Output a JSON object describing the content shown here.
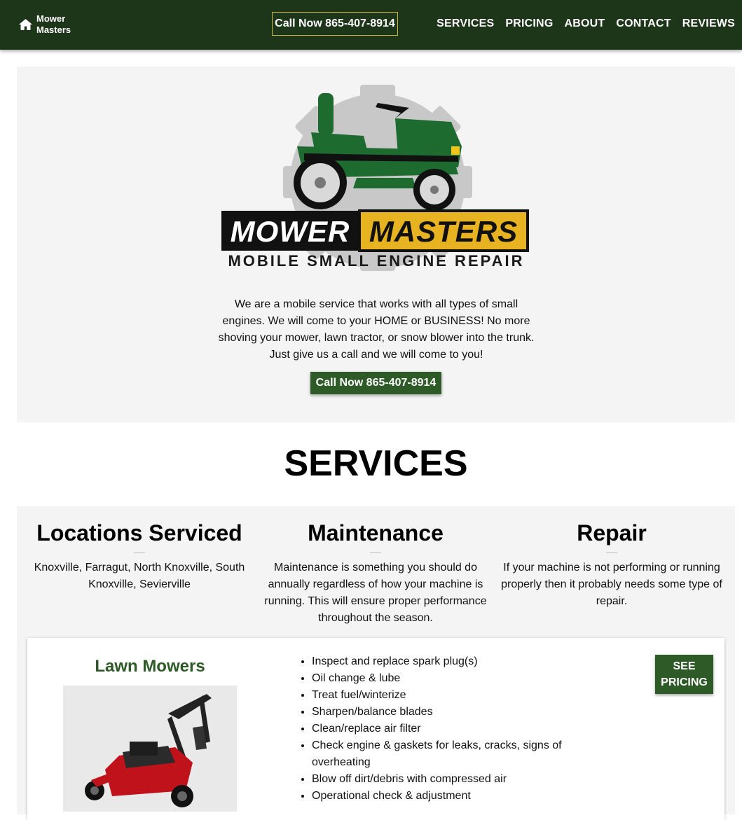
{
  "nav": {
    "brand_line1": "Mower",
    "brand_line2": "Masters",
    "call_label": "Call Now 865-407-8914",
    "links": [
      "SERVICES",
      "PRICING",
      "ABOUT",
      "CONTACT",
      "REVIEWS"
    ]
  },
  "hero": {
    "logo_word1": "MOWER",
    "logo_word2": "MASTERS",
    "tagline": "MOBILE SMALL ENGINE REPAIR",
    "description": "We are a mobile service that works with all types of small engines. We will come to your HOME or BUSINESS! No more shoving your mower, lawn tractor, or snow blower into the trunk. Just give us a call and we will come to you!",
    "call_label": "Call Now 865-407-8914"
  },
  "services": {
    "title": "SERVICES",
    "columns": [
      {
        "title": "Locations Serviced",
        "text": "Knoxville, Farragut, North Knoxville, South Knoxville, Sevierville"
      },
      {
        "title": "Maintenance",
        "text": "Maintenance is something you should do annually regardless of how your machine is running. This will ensure proper performance throughout the season."
      },
      {
        "title": "Repair",
        "text": "If your machine is not performing or running properly then it probably needs some type of repair."
      }
    ],
    "card": {
      "title": "Lawn Mowers",
      "items": [
        "Inspect and replace spark plug(s)",
        "Oil change & lube",
        "Treat fuel/winterize",
        "Sharpen/balance blades",
        "Clean/replace air filter",
        "Check engine & gaskets for leaks, cracks, signs of overheating",
        "Blow off dirt/debris with compressed air",
        "Operational check & adjustment"
      ],
      "pricing_line1": "SEE",
      "pricing_line2": "PRICING"
    }
  },
  "colors": {
    "nav_bg": "#1d3519",
    "accent_green": "#2d5a27",
    "logo_yellow": "#e8b320",
    "tractor_green": "#1e6b30",
    "section_bg": "#f4f4f4"
  }
}
